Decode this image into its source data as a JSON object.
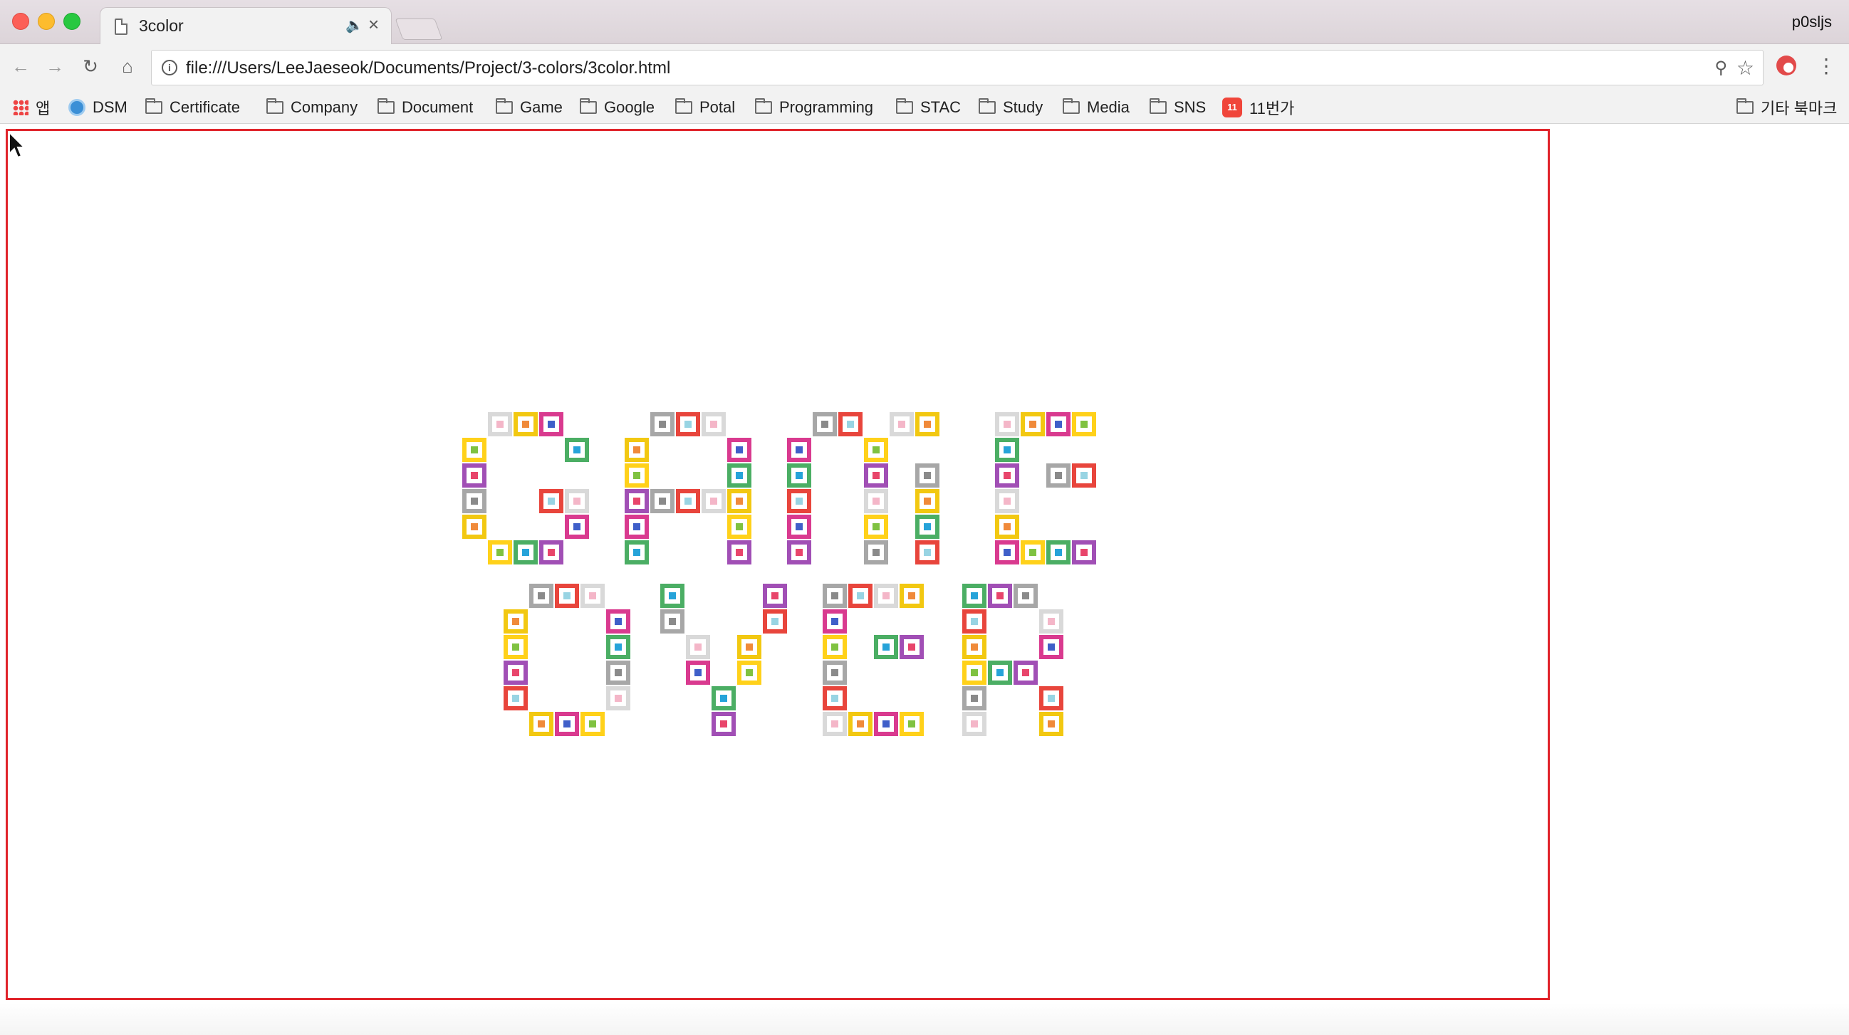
{
  "browser": {
    "tab_title": "3color",
    "profile_name": "p0sljs",
    "url": "file:///Users/LeeJaeseok/Documents/Project/3-colors/3color.html",
    "audio_icon": "speaker-icon",
    "close_icon": "close-icon"
  },
  "bookmarks": [
    {
      "label": "앱",
      "icon": "apps-icon"
    },
    {
      "label": "DSM",
      "icon": "dsm-icon"
    },
    {
      "label": "Certificate",
      "icon": "folder-icon"
    },
    {
      "label": "Company",
      "icon": "folder-icon"
    },
    {
      "label": "Document",
      "icon": "folder-icon"
    },
    {
      "label": "Game",
      "icon": "folder-icon"
    },
    {
      "label": "Google",
      "icon": "folder-icon"
    },
    {
      "label": "Potal",
      "icon": "folder-icon"
    },
    {
      "label": "Programming",
      "icon": "folder-icon"
    },
    {
      "label": "STAC",
      "icon": "folder-icon"
    },
    {
      "label": "Study",
      "icon": "folder-icon"
    },
    {
      "label": "Media",
      "icon": "folder-icon"
    },
    {
      "label": "SNS",
      "icon": "folder-icon"
    },
    {
      "label": "11번가",
      "icon": "11st-icon"
    }
  ],
  "other_bookmarks": "기타 북마크",
  "game": {
    "canvas_border_color": "#e0242b",
    "message_words": [
      "GAME",
      "OVER"
    ]
  }
}
